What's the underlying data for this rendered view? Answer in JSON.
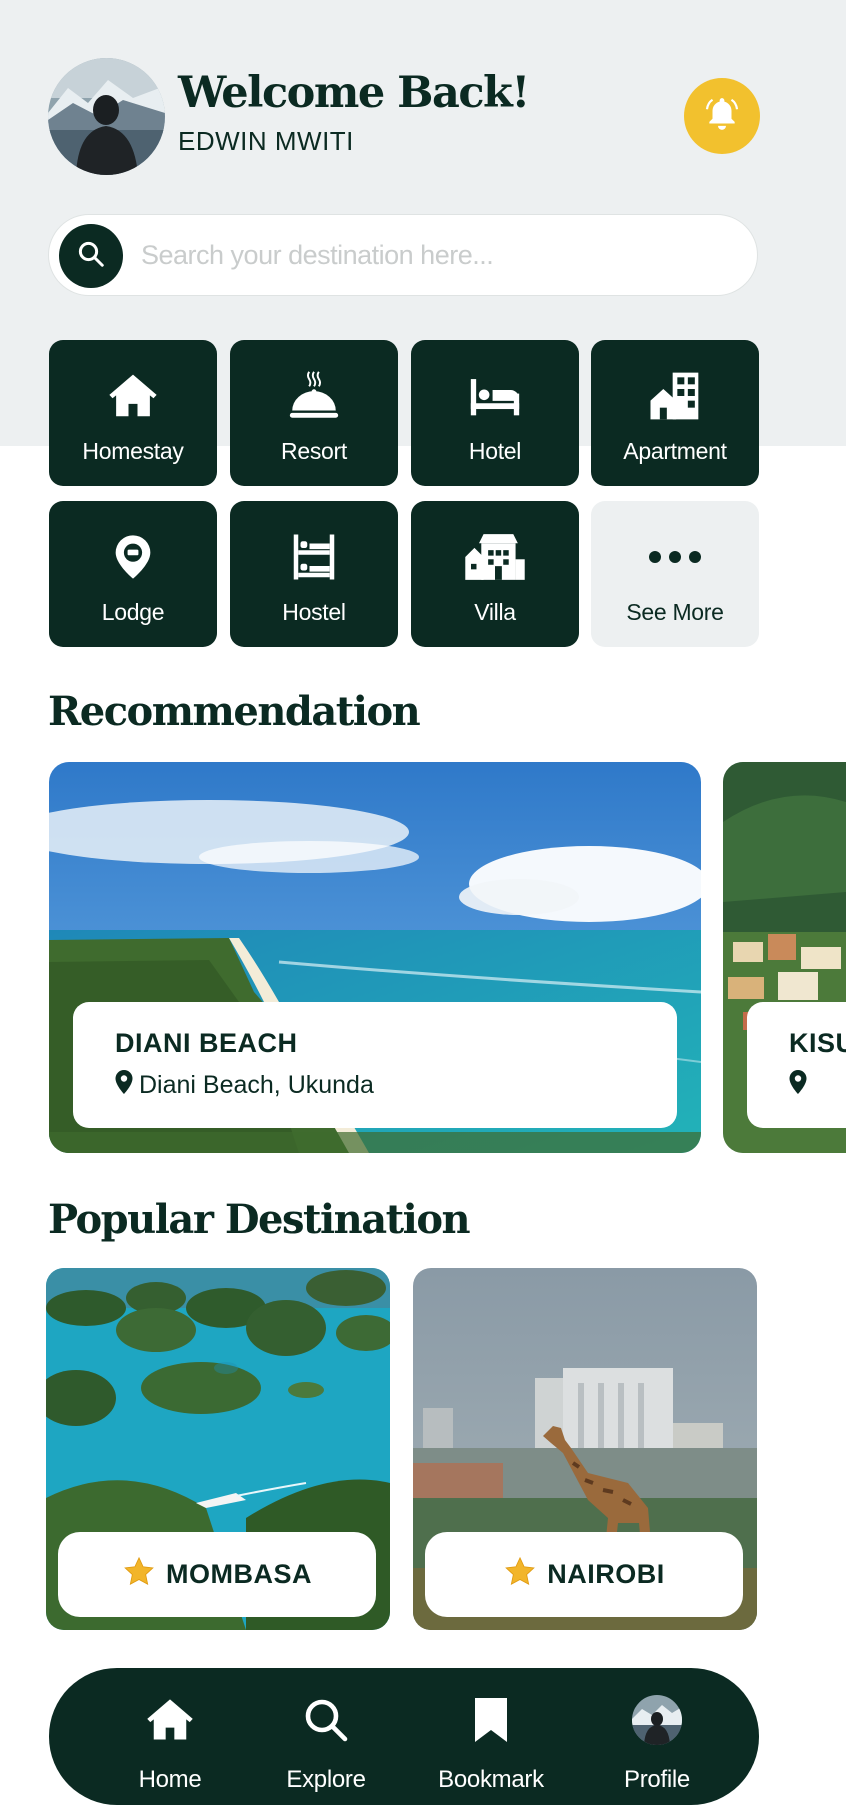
{
  "header": {
    "greeting": "Welcome Back!",
    "username": "EDWIN MWITI"
  },
  "search": {
    "placeholder": "Search your destination here..."
  },
  "categories": [
    {
      "label": "Homestay",
      "icon": "home-icon"
    },
    {
      "label": "Resort",
      "icon": "resort-icon"
    },
    {
      "label": "Hotel",
      "icon": "bed-icon"
    },
    {
      "label": "Apartment",
      "icon": "apartment-icon"
    },
    {
      "label": "Lodge",
      "icon": "location-pin-icon"
    },
    {
      "label": "Hostel",
      "icon": "bunk-bed-icon"
    },
    {
      "label": "Villa",
      "icon": "villa-icon"
    },
    {
      "label": "See More",
      "icon": "more-dots-icon"
    }
  ],
  "recommendation": {
    "title": "Recommendation",
    "items": [
      {
        "name": "DIANI BEACH",
        "location": "Diani Beach, Ukunda"
      },
      {
        "name": "KISU",
        "location": ""
      }
    ]
  },
  "popular": {
    "title": "Popular Destination",
    "items": [
      {
        "name": "MOMBASA"
      },
      {
        "name": "NAIROBI"
      }
    ]
  },
  "nav": [
    {
      "label": "Home",
      "icon": "home-icon"
    },
    {
      "label": "Explore",
      "icon": "search-icon"
    },
    {
      "label": "Bookmark",
      "icon": "bookmark-icon"
    },
    {
      "label": "Profile",
      "icon": "avatar"
    }
  ],
  "colors": {
    "primary": "#0b2a22",
    "accent": "#f2c12e",
    "background": "#edf0f1"
  }
}
